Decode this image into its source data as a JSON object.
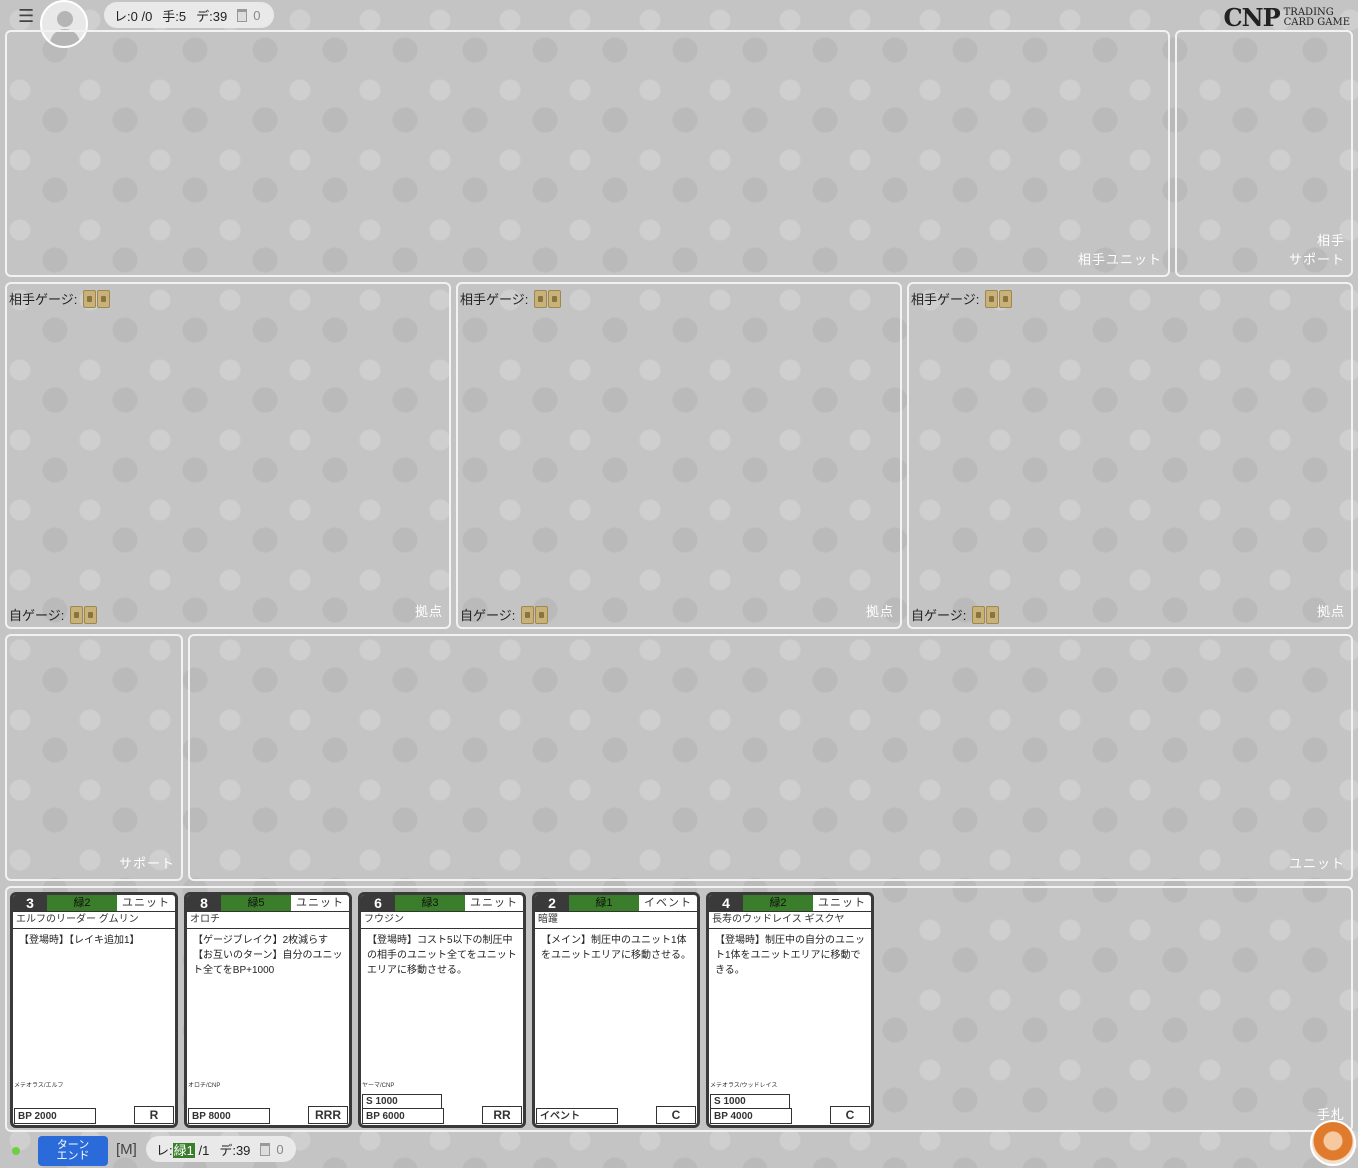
{
  "topbar": {
    "menu_icon": "☰",
    "status": {
      "level": "レ:0 /0",
      "hand": "手:5",
      "deck": "デ:39",
      "trash": "0"
    }
  },
  "logo": {
    "main": "CNP",
    "sub_line1": "TRADING",
    "sub_line2": "CARD GAME"
  },
  "zones": {
    "opponent_unit": "相手ユニット",
    "opponent_support_1": "相手",
    "opponent_support_2": "サポート",
    "base": "拠点",
    "opponent_gauge": "相手ゲージ:",
    "own_gauge": "自ゲージ:",
    "support": "サポート",
    "unit": "ユニット",
    "hand": "手札"
  },
  "cards": [
    {
      "cost": "3",
      "color": "緑2",
      "type": "ユニット",
      "name": "エルフのリーダー グムリン",
      "text": "【登場時】【レイキ追加1】",
      "tribe": "メテオラス/エルフ",
      "s": "",
      "bp": "BP 2000",
      "rarity": "R"
    },
    {
      "cost": "8",
      "color": "緑5",
      "type": "ユニット",
      "name": "オロチ",
      "text": "【ゲージブレイク】2枚減らす 【お互いのターン】自分のユニット全てをBP+1000",
      "tribe": "オロチ/CNP",
      "s": "",
      "bp": "BP 8000",
      "rarity": "RRR"
    },
    {
      "cost": "6",
      "color": "緑3",
      "type": "ユニット",
      "name": "フウジン",
      "text": "【登場時】コスト5以下の制圧中の相手のユニット全てをユニットエリアに移動させる。",
      "tribe": "ヤーマ/CNP",
      "s": "S 1000",
      "bp": "BP 6000",
      "rarity": "RR"
    },
    {
      "cost": "2",
      "color": "緑1",
      "type": "イベント",
      "name": "暗躍",
      "text": "【メイン】制圧中のユニット1体をユニットエリアに移動させる。",
      "tribe": "",
      "s": "",
      "bp": "イベント",
      "rarity": "C"
    },
    {
      "cost": "4",
      "color": "緑2",
      "type": "ユニット",
      "name": "長寿のウッドレイス ギスクヤ",
      "text": "【登場時】制圧中の自分のユニット1体をユニットエリアに移動できる。",
      "tribe": "メテオラス/ウッドレイス",
      "s": "S 1000",
      "bp": "BP 4000",
      "rarity": "C"
    }
  ],
  "bottombar": {
    "end_turn_line1": "ターン",
    "end_turn_line2": "エンド",
    "mode": "[M]",
    "level_prefix": "レ:",
    "level_value": "緑1",
    "level_suffix": " /1",
    "deck": "デ:39",
    "trash": "0"
  },
  "colors": {
    "accent_green": "#3a7d2a",
    "end_turn_blue": "#2a6ad9",
    "card_border": "#3a3a3a"
  }
}
